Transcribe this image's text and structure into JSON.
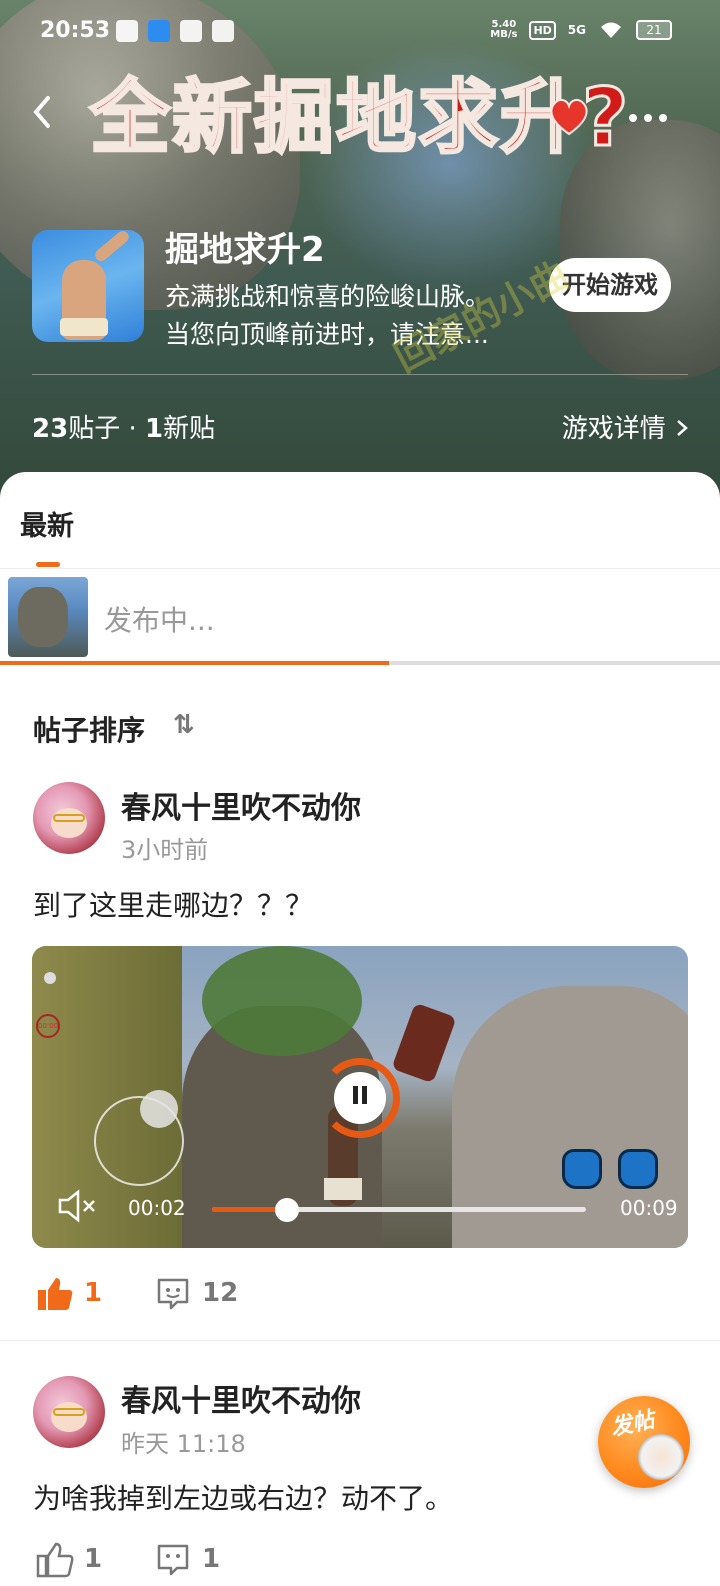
{
  "status_bar": {
    "time": "20:53",
    "net_speed": "5.40",
    "net_unit": "MB/s",
    "hd": "HD",
    "signal": "5G",
    "battery": "21"
  },
  "header": {
    "banner_title": "全新掘地求升?",
    "game_name": "掘地求升2",
    "game_desc_line1": "充满挑战和惊喜的险峻山脉。",
    "game_desc_line2": "当您向顶峰前进时，请注意...",
    "start_button": "开始游戏",
    "watermark": "回家的小曲",
    "posts_count": "23",
    "posts_label": "贴子",
    "separator": "·",
    "new_count": "1",
    "new_label": "新贴",
    "game_detail": "游戏详情",
    "back_icon": "back-arrow-icon",
    "more_icon": "more-dots-icon"
  },
  "tabs": {
    "latest": "最新"
  },
  "publishing": {
    "text": "发布中...",
    "progress": 0.54
  },
  "sort": {
    "label": "帖子排序",
    "icon": "⇅"
  },
  "posts": [
    {
      "username": "春风十里吹不动你",
      "time": "3小时前",
      "text": "到了这里走哪边？？？",
      "video": {
        "current": "00:02",
        "duration": "00:09",
        "progress": 0.2,
        "state": "playing"
      },
      "likes": "1",
      "comments": "12"
    },
    {
      "username": "春风十里吹不动你",
      "time": "昨天 11:18",
      "text": "为啥我掉到左边或右边？动不了。",
      "likes": "1",
      "comments": "1"
    }
  ],
  "fab": {
    "label": "发帖"
  },
  "colors": {
    "accent": "#f06a1a",
    "title_red": "#d11b18"
  }
}
